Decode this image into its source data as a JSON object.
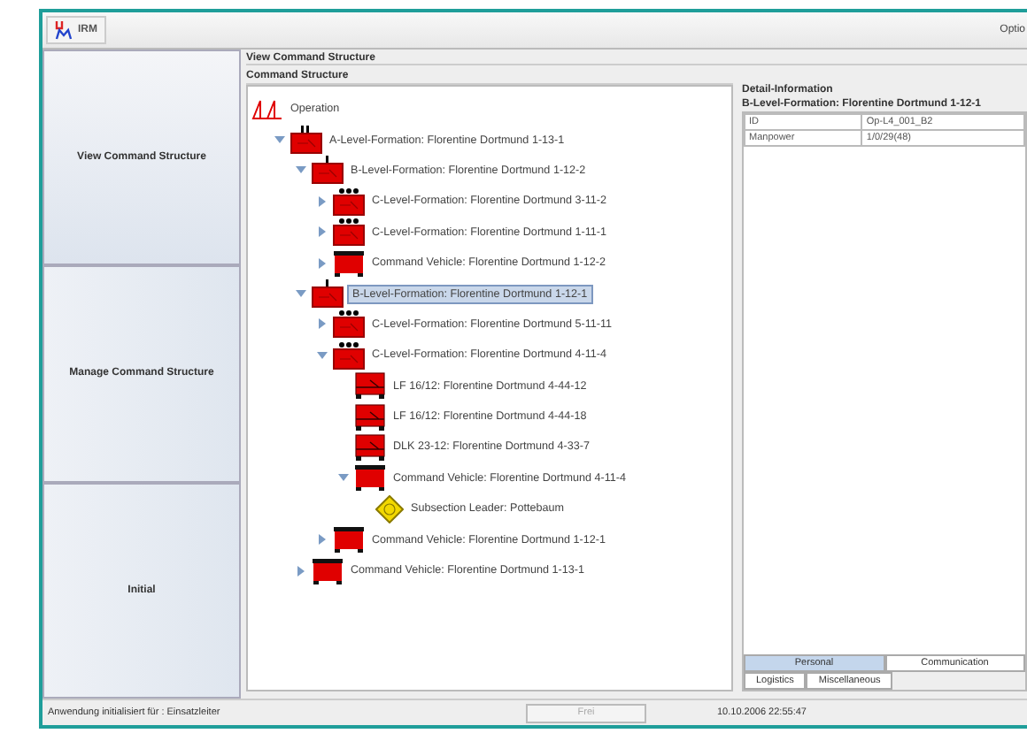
{
  "toolbar": {
    "app_name": "IRM",
    "menu": "Optio"
  },
  "sidebar": [
    {
      "label": "View Command Structure",
      "selected": true
    },
    {
      "label": "Manage Command Structure",
      "selected": false
    },
    {
      "label": "Initial",
      "selected": false
    }
  ],
  "view_title": "View Command Structure",
  "tree": {
    "title": "Command Structure",
    "root": {
      "label": "Operation",
      "kind": "operation",
      "selected": false,
      "children": [
        {
          "label": "A-Level-Formation: Florentine Dortmund 1-13-1",
          "kind": "a-level",
          "expanded": true,
          "selected": false,
          "children": [
            {
              "label": "B-Level-Formation: Florentine Dortmund 1-12-2",
              "kind": "b-level",
              "expanded": true,
              "selected": false,
              "children": [
                {
                  "label": "C-Level-Formation: Florentine Dortmund 3-11-2",
                  "kind": "c-level",
                  "expanded": false,
                  "selected": false
                },
                {
                  "label": "C-Level-Formation: Florentine Dortmund 1-11-1",
                  "kind": "c-level",
                  "expanded": false,
                  "selected": false
                },
                {
                  "label": "Command Vehicle: Florentine Dortmund 1-12-2",
                  "kind": "vehicle",
                  "expanded": false,
                  "selected": false
                }
              ]
            },
            {
              "label": "B-Level-Formation: Florentine Dortmund 1-12-1",
              "kind": "b-level",
              "expanded": true,
              "selected": true,
              "children": [
                {
                  "label": "C-Level-Formation: Florentine Dortmund 5-11-11",
                  "kind": "c-level",
                  "expanded": false,
                  "selected": false
                },
                {
                  "label": "C-Level-Formation: Florentine Dortmund 4-11-4",
                  "kind": "c-level",
                  "expanded": true,
                  "selected": false,
                  "children": [
                    {
                      "label": "LF 16/12: Florentine Dortmund 4-44-12",
                      "kind": "unit",
                      "selected": false
                    },
                    {
                      "label": "LF 16/12: Florentine Dortmund 4-44-18",
                      "kind": "unit",
                      "selected": false
                    },
                    {
                      "label": "DLK 23-12: Florentine Dortmund 4-33-7",
                      "kind": "unit",
                      "selected": false
                    },
                    {
                      "label": "Command Vehicle: Florentine Dortmund 4-11-4",
                      "kind": "vehicle",
                      "expanded": true,
                      "selected": false,
                      "children": [
                        {
                          "label": "Subsection Leader: Pottebaum",
                          "kind": "leader",
                          "selected": false
                        }
                      ]
                    }
                  ]
                },
                {
                  "label": "Command Vehicle: Florentine Dortmund 1-12-1",
                  "kind": "vehicle",
                  "expanded": false,
                  "selected": false
                }
              ]
            },
            {
              "label": "Command Vehicle: Florentine Dortmund 1-13-1",
              "kind": "vehicle",
              "expanded": false,
              "selected": false
            }
          ]
        }
      ]
    }
  },
  "detail": {
    "title": "Detail-Information",
    "heading": "B-Level-Formation: Florentine Dortmund 1-12-1",
    "rows": [
      {
        "key": "ID",
        "value": "Op-L4_001_B2"
      },
      {
        "key": "Manpower",
        "value": "1/0/29(48)"
      }
    ],
    "tabs": [
      [
        {
          "label": "Personal",
          "selected": true
        },
        {
          "label": "Communication",
          "selected": false
        }
      ],
      [
        {
          "label": "Logistics",
          "selected": false
        },
        {
          "label": "Miscellaneous",
          "selected": false
        }
      ]
    ]
  },
  "status_bar": {
    "message": "Anwendung initialisiert für : Einsatzleiter",
    "button": {
      "label": "Frei",
      "disabled": true
    },
    "datetime": "10.10.2006 22:55:47"
  }
}
